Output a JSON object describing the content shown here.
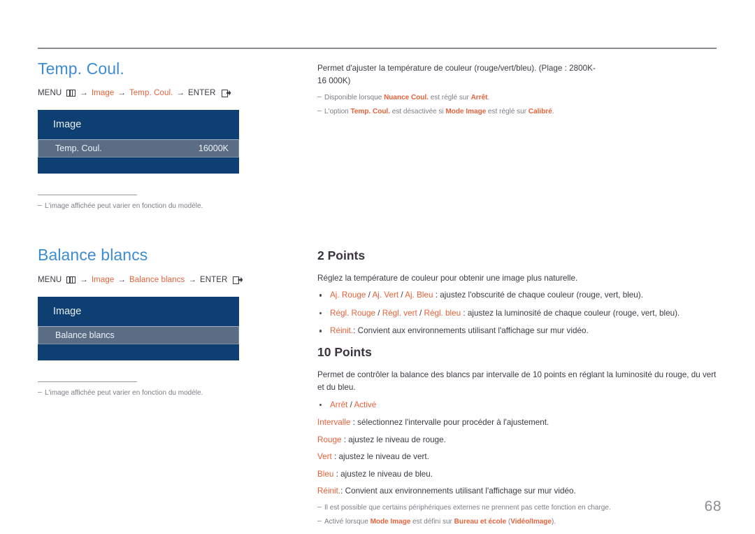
{
  "page": {
    "number": "68"
  },
  "sections": {
    "temp_coul": {
      "title": "Temp. Coul.",
      "breadcrumb": {
        "menu_label": "MENU",
        "menu_icon": "menu-bars-icon",
        "arrow": "→",
        "item1": "Image",
        "item2": "Temp. Coul.",
        "enter_label": "ENTER",
        "enter_icon": "enter-arrow-icon"
      },
      "osd": {
        "header": "Image",
        "selected_label": "Temp. Coul.",
        "selected_value": "16000K"
      },
      "note_rule": true,
      "note": "L'image affichée peut varier en fonction du modèle.",
      "description": "Permet d'ajuster la température de couleur (rouge/vert/bleu). (Plage : 2800K-16 000K)",
      "notes": [
        {
          "parts": [
            {
              "text": "Disponible lorsque ",
              "accent": false
            },
            {
              "text": "Nuance Coul.",
              "accent": true
            },
            {
              "text": " est réglé sur ",
              "accent": false
            },
            {
              "text": "Arrêt",
              "accent": true
            },
            {
              "text": ".",
              "accent": false
            }
          ]
        },
        {
          "parts": [
            {
              "text": "L'option ",
              "accent": false
            },
            {
              "text": "Temp. Coul.",
              "accent": true
            },
            {
              "text": " est désactivée si ",
              "accent": false
            },
            {
              "text": "Mode Image",
              "accent": true
            },
            {
              "text": " est réglé sur ",
              "accent": false
            },
            {
              "text": "Calibré",
              "accent": true
            },
            {
              "text": ".",
              "accent": false
            }
          ]
        }
      ]
    },
    "balance_blancs": {
      "title": "Balance blancs",
      "breadcrumb": {
        "menu_label": "MENU",
        "menu_icon": "menu-bars-icon",
        "arrow": "→",
        "item1": "Image",
        "item2": "Balance blancs",
        "enter_label": "ENTER",
        "enter_icon": "enter-arrow-icon"
      },
      "osd": {
        "header": "Image",
        "selected_label": "Balance blancs",
        "selected_value": ""
      },
      "note": "L'image affichée peut varier en fonction du modèle."
    },
    "two_points": {
      "title": "2 Points",
      "intro": "Réglez la température de couleur pour obtenir une image plus naturelle.",
      "bullets": [
        {
          "parts": [
            {
              "text": "Aj. Rouge",
              "accent": true
            },
            {
              "text": " / ",
              "accent": false
            },
            {
              "text": "Aj. Vert",
              "accent": true
            },
            {
              "text": " / ",
              "accent": false
            },
            {
              "text": "Aj. Bleu",
              "accent": true
            },
            {
              "text": " : ajustez l'obscurité de chaque couleur (rouge, vert, bleu).",
              "accent": false
            }
          ]
        },
        {
          "parts": [
            {
              "text": "Régl. Rouge",
              "accent": true
            },
            {
              "text": " / ",
              "accent": false
            },
            {
              "text": "Régl. vert",
              "accent": true
            },
            {
              "text": " / ",
              "accent": false
            },
            {
              "text": "Régl. bleu",
              "accent": true
            },
            {
              "text": " : ajustez la luminosité de chaque couleur (rouge, vert, bleu).",
              "accent": false
            }
          ]
        },
        {
          "parts": [
            {
              "text": "Réinit.",
              "accent": true
            },
            {
              "text": ": Convient aux environnements utilisant l'affichage sur mur vidéo.",
              "accent": false
            }
          ]
        }
      ]
    },
    "ten_points": {
      "title": "10 Points",
      "intro": "Permet de contrôler la balance des blancs par intervalle de 10 points en réglant la luminosité du rouge, du vert et du bleu.",
      "bullets": [
        {
          "parts": [
            {
              "text": "Arrêt",
              "accent": true
            },
            {
              "text": " / ",
              "accent": false
            },
            {
              "text": "Activé",
              "accent": true
            }
          ]
        }
      ],
      "lines": [
        {
          "parts": [
            {
              "text": "Intervalle",
              "accent": true
            },
            {
              "text": " : sélectionnez l'intervalle pour procéder à l'ajustement.",
              "accent": false
            }
          ]
        },
        {
          "parts": [
            {
              "text": "Rouge",
              "accent": true
            },
            {
              "text": " : ajustez le niveau de rouge.",
              "accent": false
            }
          ]
        },
        {
          "parts": [
            {
              "text": "Vert",
              "accent": true
            },
            {
              "text": " : ajustez le niveau de vert.",
              "accent": false
            }
          ]
        },
        {
          "parts": [
            {
              "text": "Bleu",
              "accent": true
            },
            {
              "text": " : ajustez le niveau de bleu.",
              "accent": false
            }
          ]
        },
        {
          "parts": [
            {
              "text": "Réinit.",
              "accent": true
            },
            {
              "text": ": Convient aux environnements utilisant l'affichage sur mur vidéo.",
              "accent": false
            }
          ]
        }
      ],
      "notes": [
        {
          "parts": [
            {
              "text": "Il est possible que certains périphériques externes ne prennent pas cette fonction en charge.",
              "accent": false
            }
          ]
        },
        {
          "parts": [
            {
              "text": "Activé lorsque ",
              "accent": false
            },
            {
              "text": "Mode Image",
              "accent": true
            },
            {
              "text": " est défini sur ",
              "accent": false
            },
            {
              "text": "Bureau et école",
              "accent": true
            },
            {
              "text": " (",
              "accent": false
            },
            {
              "text": "Vidéo/Image",
              "accent": true
            },
            {
              "text": ").",
              "accent": false
            }
          ]
        }
      ]
    }
  },
  "colors": {
    "heading_blue": "#3d8cd2",
    "accent_orange": "#e8613a",
    "osd_dark_blue": "#0d3f73",
    "osd_selected": "#5a6d85",
    "body_text": "#3b3b46",
    "note_text": "#7d7d88",
    "page_number": "#8d8d97"
  }
}
